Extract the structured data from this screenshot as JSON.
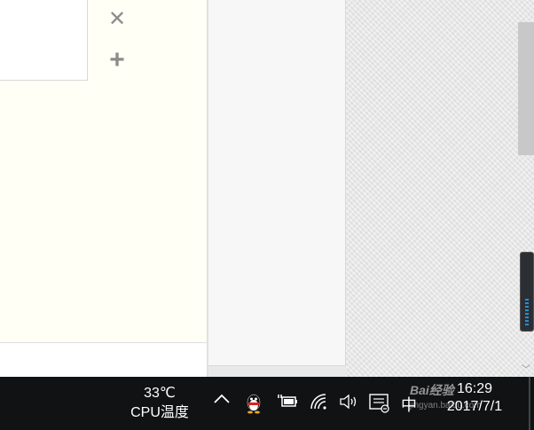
{
  "left_panel": {
    "close_glyph": "✕",
    "add_glyph": "+"
  },
  "taskbar": {
    "cpu_temperature": "33℃",
    "cpu_label": "CPU温度",
    "ime_label": "中",
    "clock_time": "16:29",
    "clock_date": "2017/7/1",
    "watermark": "Bai经验",
    "watermark_sub": "jingyan.baidu.com"
  },
  "icons": {
    "chevron": "chevron-up-icon",
    "qq": "qq-penguin-icon",
    "battery": "battery-plug-icon",
    "wifi": "wifi-icon",
    "volume": "volume-icon",
    "notification": "notification-center-icon"
  },
  "colors": {
    "taskbar": "#101214",
    "panel": "#fffff6",
    "accent": "#2a8ccf"
  }
}
